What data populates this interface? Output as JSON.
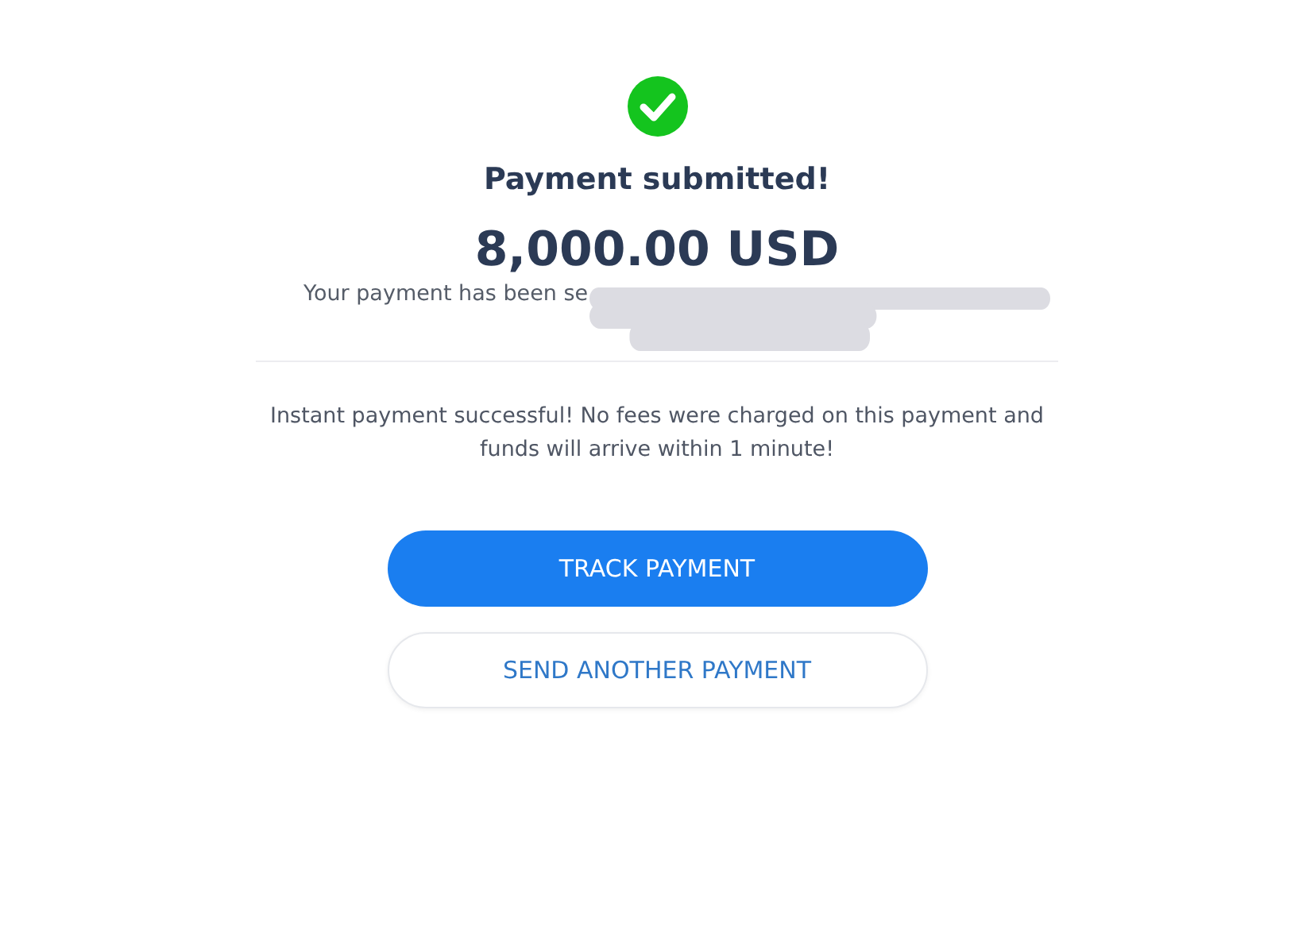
{
  "status": {
    "kind": "success"
  },
  "title": "Payment submitted!",
  "amount": "8,000.00 USD",
  "recipient_text": "Your payment has been se",
  "recipient_redacted": true,
  "notice": "Instant payment successful! No fees were charged on this payment and funds will arrive within 1 minute!",
  "buttons": [
    {
      "label": "TRACK PAYMENT",
      "kind": "primary"
    },
    {
      "label": "SEND ANOTHER PAYMENT",
      "kind": "secondary"
    }
  ]
}
